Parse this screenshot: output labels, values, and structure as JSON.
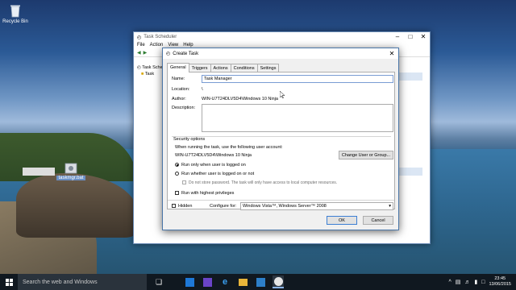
{
  "desktop": {
    "recycle_bin_label": "Recycle Bin",
    "file_icon_label": "taskmgr.bat"
  },
  "bg_window": {
    "title": "Task Scheduler",
    "menu": [
      "File",
      "Action",
      "View",
      "Help"
    ],
    "tree": [
      "Task Sche",
      "Task"
    ]
  },
  "dialog": {
    "title": "Create Task",
    "tabs": [
      "General",
      "Triggers",
      "Actions",
      "Conditions",
      "Settings"
    ],
    "name_label": "Name:",
    "name_value": "Task Manager",
    "location_label": "Location:",
    "location_value": "\\",
    "author_label": "Author:",
    "author_value": "WIN-U7T24DLV5D4\\Windows 10 Ninja",
    "description_label": "Description:",
    "security_header": "Security options",
    "run_account_text": "When running the task, use the following user account:",
    "account_value": "WIN-U7T24DLV5D4\\Windows 10 Ninja",
    "change_user_button": "Change User or Group...",
    "radio_logged_on": "Run only when user is logged on",
    "radio_whether": "Run whether user is logged on or not",
    "no_store_password": "Do not store password. The task will only have access to local computer resources.",
    "highest_priv": "Run with highest privileges",
    "hidden_label": "Hidden",
    "configure_label": "Configure for:",
    "configure_value": "Windows Vista™, Windows Server™ 2008",
    "ok_button": "OK",
    "cancel_button": "Cancel"
  },
  "taskbar": {
    "search_placeholder": "Search the web and Windows",
    "time": "23:45",
    "date": "13/06/2015"
  }
}
